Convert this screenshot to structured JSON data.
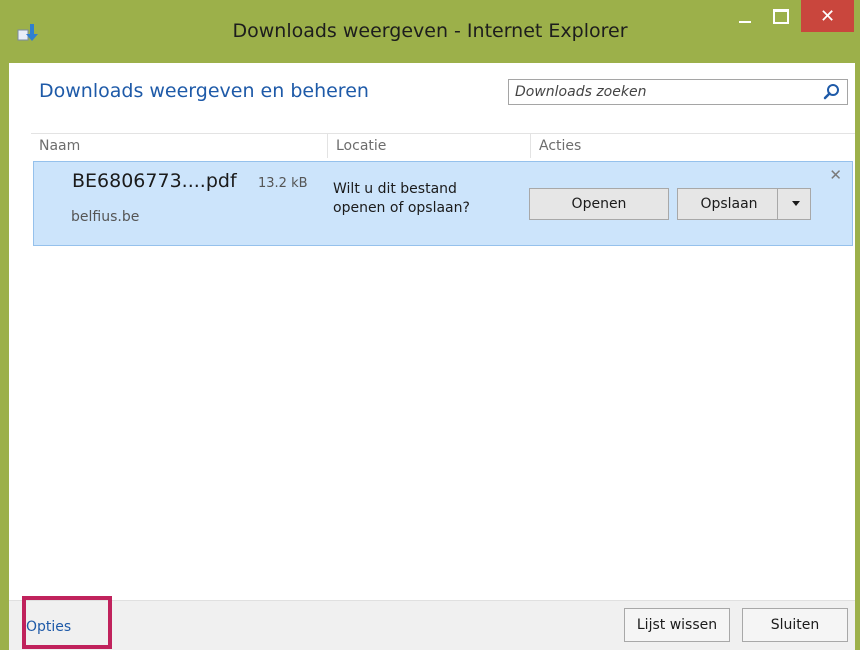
{
  "window": {
    "title": "Downloads weergeven - Internet Explorer",
    "controls": {
      "minimize": "minimize-icon",
      "maximize": "maximize-icon",
      "close": "✕"
    }
  },
  "header": {
    "heading": "Downloads weergeven en beheren",
    "search_placeholder": "Downloads zoeken"
  },
  "columns": [
    "Naam",
    "Locatie",
    "Acties"
  ],
  "downloads": [
    {
      "filename": "BE6806773....pdf",
      "size": "13.2 kB",
      "site": "belfius.be",
      "question": "Wilt u dit bestand openen of opslaan?",
      "open_label": "Openen",
      "save_label": "Opslaan",
      "remove": "✕"
    }
  ],
  "footer": {
    "options_label": "Opties",
    "clear_label": "Lijst wissen",
    "close_label": "Sluiten"
  },
  "colors": {
    "frame": "#9cb04a",
    "accent_link": "#1e5aa8",
    "selection": "#cce4fb",
    "highlight": "#c0225c",
    "close_button": "#c9463d"
  }
}
